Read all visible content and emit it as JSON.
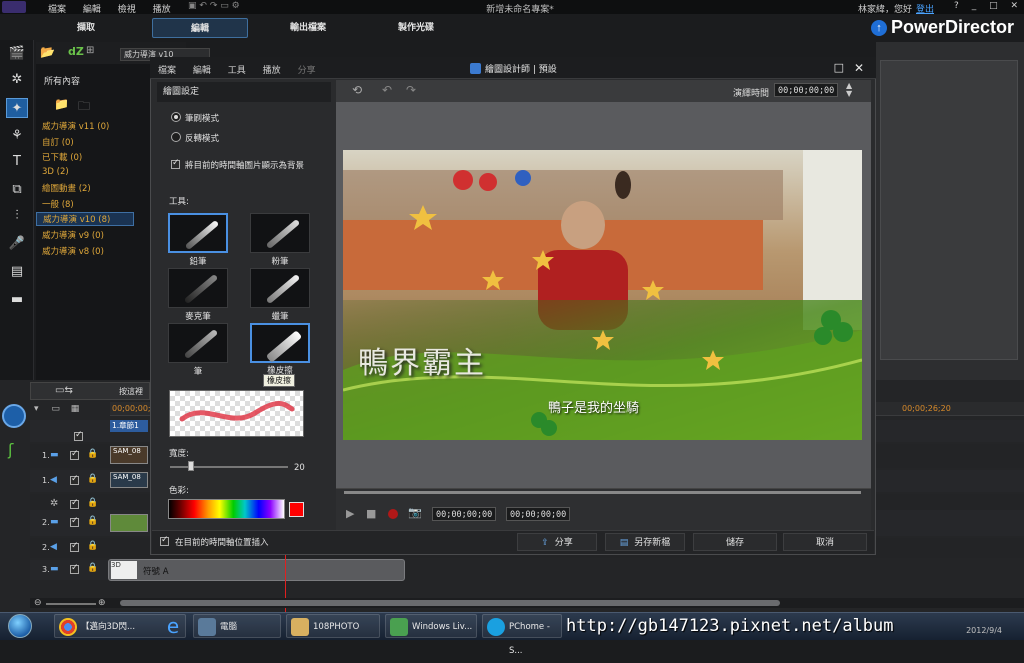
{
  "titlebar": {
    "menu": [
      "檔案",
      "編輯",
      "檢視",
      "播放"
    ],
    "app_title": "新增未命名專案*",
    "user": "林家緯，您好",
    "login": "登出",
    "help": "?"
  },
  "tabs": [
    "擷取",
    "編輯",
    "輸出檔案",
    "製作光碟"
  ],
  "brand": "PowerDirector",
  "library": {
    "dropdown": "威力導演 v10",
    "root": "所有內容",
    "items": [
      "威力導演 v11  (0)",
      "自訂  (0)",
      "已下載  (0)",
      "3D  (2)",
      "繪圖動畫  (2)",
      "一般  (8)",
      "威力導演 v10  (8)",
      "威力導演 v9  (0)",
      "威力導演 v8  (0)"
    ]
  },
  "dialog": {
    "menu": [
      "檔案",
      "編輯",
      "工具",
      "播放",
      "分享"
    ],
    "title": "繪圖設計師 | 預設",
    "settings_header": "繪圖設定",
    "mode_brush": "筆刷模式",
    "mode_invert": "反轉模式",
    "show_bg": "將目前的時間軸圖片顯示為背景",
    "tools_label": "工具:",
    "brushes": [
      "鉛筆",
      "粉筆",
      "麥克筆",
      "蠟筆",
      "筆",
      "橡皮擦"
    ],
    "tooltip": "橡皮擦",
    "width_label": "寬度:",
    "width_value": "20",
    "color_label": "色彩:",
    "duration_label": "演繹時間",
    "duration_value": "00;00;00;00",
    "tc_current": "00;00;00;00",
    "tc_total": "00;00;00;00",
    "insert_label": "在目前的時間軸位置插入",
    "buttons": {
      "share": "分享",
      "save_as": "另存新檔",
      "save": "儲存",
      "cancel": "取消"
    },
    "photo_text_big": "鴨界霸主",
    "photo_text_small": "鴨子是我的坐騎"
  },
  "timeline": {
    "arrange_label": "按這裡",
    "times": [
      "00;00;00;00",
      "00;00;26;20"
    ],
    "tracks": [
      "1.",
      "1.",
      "2.",
      "2.",
      "3."
    ],
    "clip_labels": [
      "1.章節1",
      "SAM_08",
      "SAM_08",
      "符號 A"
    ]
  },
  "taskbar": {
    "items": [
      "【邁向3D閃...",
      "電腦",
      "108PHOTO",
      "Windows Liv...",
      "PChome - S..."
    ],
    "date": "2012/9/4"
  },
  "watermark": "http://gb147123.pixnet.net/album",
  "colors": {
    "accent": "#4a90e2",
    "library_item": "#e0a83a",
    "timecode_orange": "#d88a2a",
    "playhead": "#e02020",
    "selected_color": "#ff0000"
  }
}
